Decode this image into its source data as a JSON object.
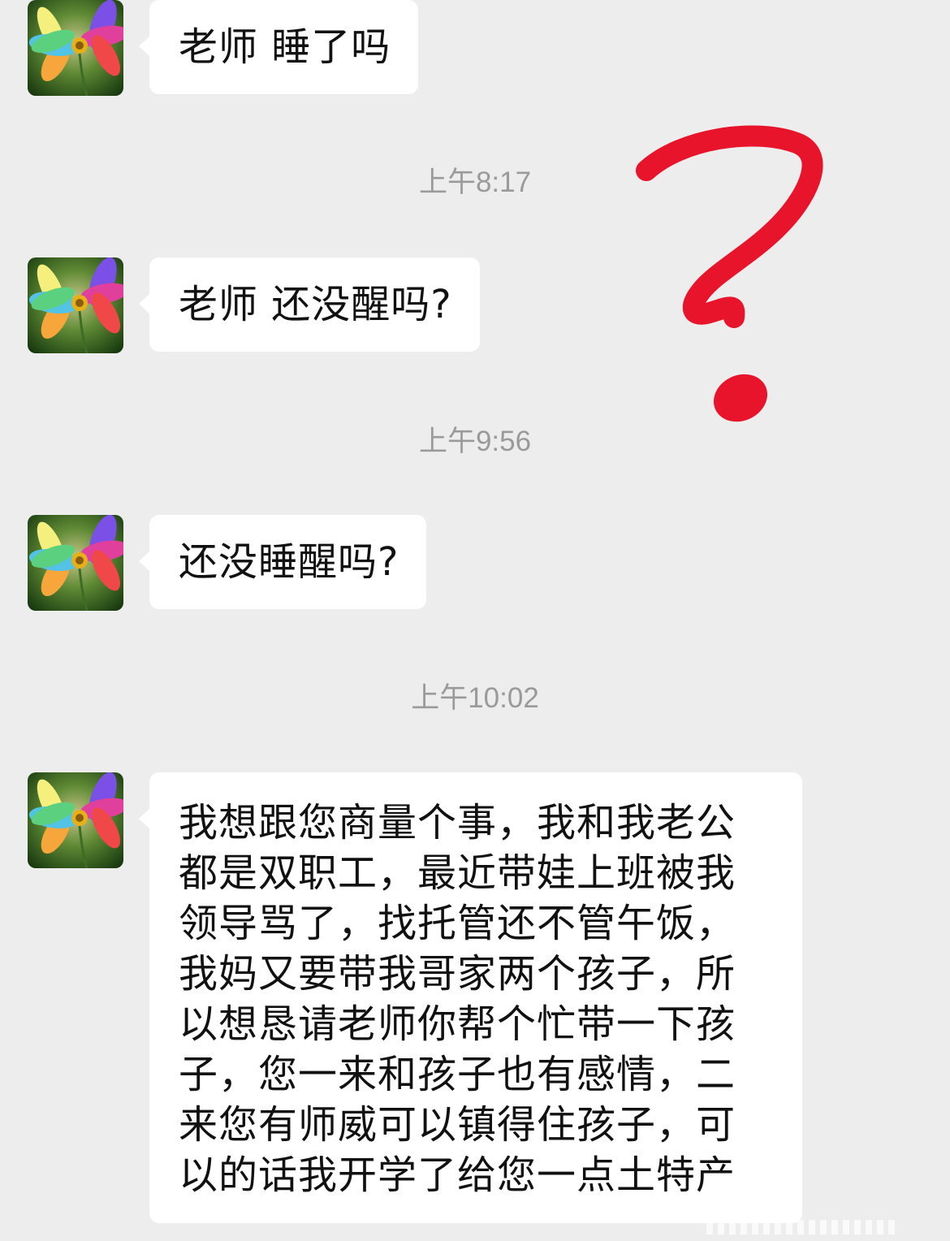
{
  "messages": [
    {
      "sender_avatar": "colorful-flower",
      "text": "老师 睡了吗"
    },
    {
      "timestamp": "上午8:17"
    },
    {
      "sender_avatar": "colorful-flower",
      "text": "老师 还没醒吗?"
    },
    {
      "timestamp": "上午9:56"
    },
    {
      "sender_avatar": "colorful-flower",
      "text": "还没睡醒吗?"
    },
    {
      "timestamp": "上午10:02"
    },
    {
      "sender_avatar": "colorful-flower",
      "text": "我想跟您商量个事，我和我老公都是双职工，最近带娃上班被我领导骂了，找托管还不管午饭，我妈又要带我哥家两个孩子，所以想恳请老师你帮个忙带一下孩子，您一来和孩子也有感情，二来您有师威可以镇得住孩子，可以的话我开学了给您一点土特产"
    }
  ],
  "annotation": {
    "symbol": "question-mark",
    "color": "#e8142c"
  },
  "colors": {
    "background": "#ededed",
    "bubble": "#ffffff",
    "timestamp": "#9a9a9a"
  }
}
